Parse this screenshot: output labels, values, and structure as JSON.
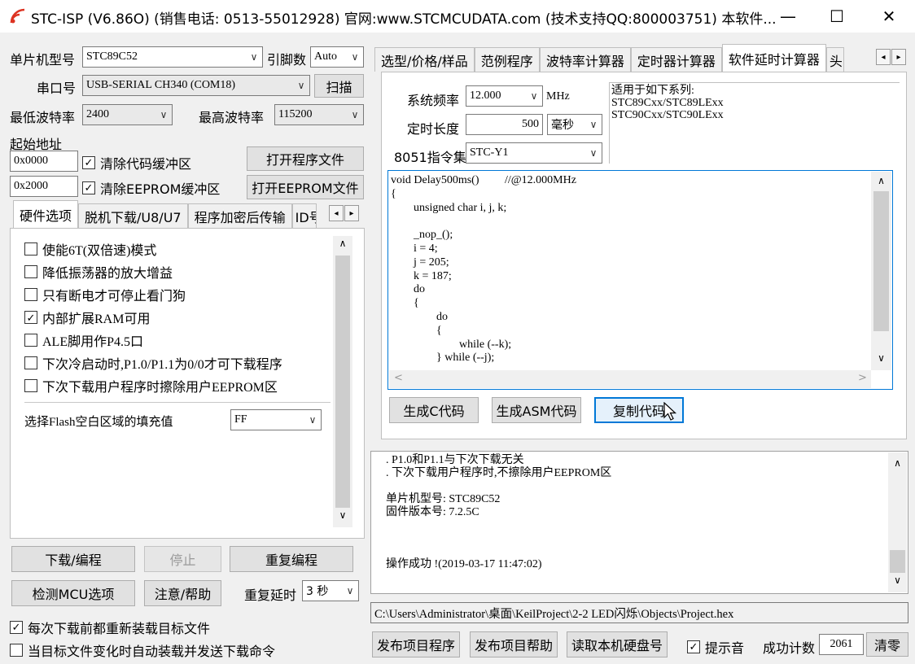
{
  "window": {
    "title": "STC-ISP (V6.86O) (销售电话: 0513-55012928) 官网:www.STCMCUDATA.com  (技术支持QQ:800003751) 本软件...",
    "minimize": "—",
    "maximize": "☐",
    "close": "✕"
  },
  "left": {
    "mcu_label": "单片机型号",
    "mcu_value": "STC89C52",
    "pins_label": "引脚数",
    "pins_value": "Auto",
    "port_label": "串口号",
    "port_value": "USB-SERIAL CH340 (COM18)",
    "scan_button": "扫描",
    "min_baud_label": "最低波特率",
    "min_baud_value": "2400",
    "max_baud_label": "最高波特率",
    "max_baud_value": "115200",
    "start_addr_label": "起始地址",
    "addr1": "0x0000",
    "clear_code_label": "清除代码缓冲区",
    "open_program_button": "打开程序文件",
    "addr2": "0x2000",
    "clear_eeprom_label": "清除EEPROM缓冲区",
    "open_eeprom_button": "打开EEPROM文件",
    "tabs": [
      "硬件选项",
      "脱机下载/U8/U7",
      "程序加密后传输",
      "ID号"
    ],
    "options": [
      {
        "label": "使能6T(双倍速)模式",
        "checked": false
      },
      {
        "label": "降低振荡器的放大增益",
        "checked": false
      },
      {
        "label": "只有断电才可停止看门狗",
        "checked": false
      },
      {
        "label": "内部扩展RAM可用",
        "checked": true
      },
      {
        "label": "ALE脚用作P4.5口",
        "checked": false
      },
      {
        "label": "下次冷启动时,P1.0/P1.1为0/0才可下载程序",
        "checked": false
      },
      {
        "label": "下次下载用户程序时擦除用户EEPROM区",
        "checked": false
      }
    ],
    "fill_label": "选择Flash空白区域的填充值",
    "fill_value": "FF",
    "download_button": "下载/编程",
    "stop_button": "停止",
    "reprogram_button": "重复编程",
    "check_mcu_button": "检测MCU选项",
    "help_button": "注意/帮助",
    "repeat_delay_label": "重复延时",
    "repeat_delay_value": "3 秒",
    "reload_label": "每次下载前都重新装载目标文件",
    "auto_send_label": "当目标文件变化时自动装载并发送下载命令"
  },
  "right": {
    "tabs": [
      "选型/价格/样品",
      "范例程序",
      "波特率计算器",
      "定时器计算器",
      "软件延时计算器",
      "头"
    ],
    "freq_label": "系统频率",
    "freq_value": "12.000",
    "freq_unit": "MHz",
    "duration_label": "定时长度",
    "duration_value": "500",
    "duration_unit": "毫秒",
    "isa_label": "8051指令集",
    "isa_value": "STC-Y1",
    "series_info": "适用于如下系列:\nSTC89Cxx/STC89LExx\nSTC90Cxx/STC90LExx",
    "code": "void Delay500ms()\t\t//@12.000MHz\n{\n\tunsigned char i, j, k;\n\n\t_nop_();\n\ti = 4;\n\tj = 205;\n\tk = 187;\n\tdo\n\t{\n\t\tdo\n\t\t{\n\t\t\twhile (--k);\n\t\t} while (--j);",
    "gen_c_button": "生成C代码",
    "gen_asm_button": "生成ASM代码",
    "copy_button": "复制代码",
    "log": ". P1.0和P1.1与下次下载无关\n. 下次下载用户程序时,不擦除用户EEPROM区\n\n单片机型号: STC89C52\n固件版本号: 7.2.5C\n\n\n\n操作成功 !(2019-03-17 11:47:02)",
    "path": "C:\\Users\\Administrator\\桌面\\KeilProject\\2-2 LED闪烁\\Objects\\Project.hex",
    "publish_button": "发布项目程序",
    "publish_help_button": "发布项目帮助",
    "read_disk_button": "读取本机硬盘号",
    "sound_label": "提示音",
    "count_label": "成功计数",
    "count_value": "2061",
    "clear_button": "清零"
  }
}
